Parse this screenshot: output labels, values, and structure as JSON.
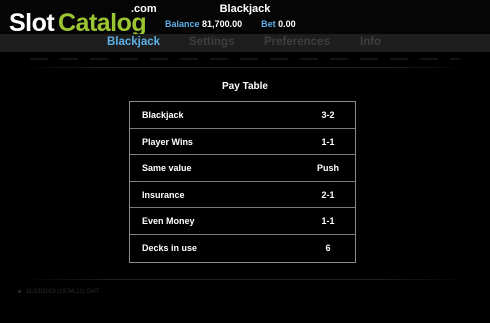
{
  "logo": {
    "part1": "Slot",
    "part2": "Catalog",
    "suffix": ".com"
  },
  "header": {
    "title": "Blackjack",
    "balance_label": "Balance",
    "balance_value": "81,700.00",
    "bet_label": "Bet",
    "bet_value": "0.00"
  },
  "tabs": [
    {
      "label": "Blackjack",
      "active": true
    },
    {
      "label": "Settings",
      "active": false
    },
    {
      "label": "Preferences",
      "active": false
    },
    {
      "label": "Info",
      "active": false
    }
  ],
  "paytable": {
    "title": "Pay Table",
    "rows": [
      {
        "name": "Blackjack",
        "value": "3-2"
      },
      {
        "name": "Player Wins",
        "value": "1-1"
      },
      {
        "name": "Same value",
        "value": "Push"
      },
      {
        "name": "Insurance",
        "value": "2-1"
      },
      {
        "name": "Even Money",
        "value": "1-1"
      },
      {
        "name": "Decks in use",
        "value": "6"
      }
    ]
  },
  "footer": {
    "timestamp": "11/13/2019 (15:34:21) GMT"
  },
  "colors": {
    "accent": "#5fb0e8",
    "brand_green": "#9cc532",
    "background": "#000000"
  }
}
